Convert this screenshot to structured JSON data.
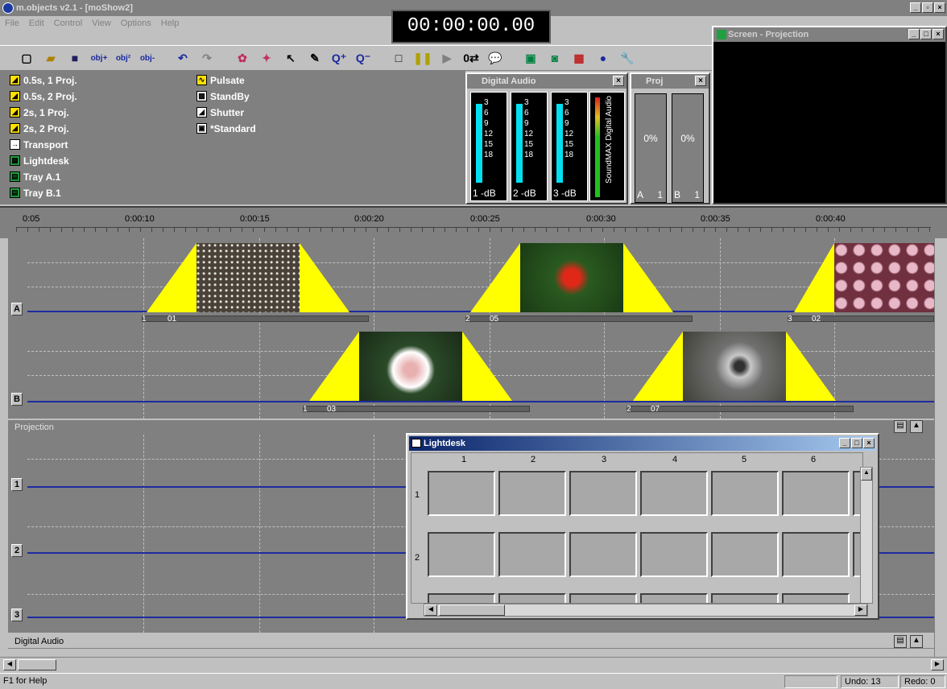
{
  "window": {
    "title": "m.objects v2.1 - [moShow2]"
  },
  "menu": [
    "File",
    "Edit",
    "Control",
    "View",
    "Options",
    "Help"
  ],
  "timer": "00:00:00.00",
  "toolbar": [
    "new",
    "open",
    "save",
    "obj+",
    "obj2",
    "obj-",
    "undo",
    "redo",
    "refresh",
    "select",
    "pointer",
    "pen",
    "zoom-in",
    "zoom-out",
    "stop",
    "pause",
    "play",
    "loop",
    "speech",
    "screen",
    "monitor",
    "lightdesk",
    "paint",
    "wrench"
  ],
  "objects": {
    "col1": [
      "0.5s, 1 Proj.",
      "0.5s, 2 Proj.",
      "2s, 1 Proj.",
      "2s, 2 Proj.",
      "Transport",
      "Lightdesk",
      "Tray A.1",
      "Tray B.1"
    ],
    "col2": [
      "Pulsate",
      "StandBy",
      "Shutter",
      "*Standard"
    ]
  },
  "digital_audio": {
    "title": "Digital Audio",
    "scale": [
      "3",
      "6",
      "9",
      "12",
      "15",
      "18"
    ],
    "channels": [
      "1",
      "2",
      "3"
    ],
    "unit": "-dB",
    "side_label": "SoundMAX Digital Audio"
  },
  "proj": {
    "title": "Proj",
    "cells": [
      {
        "value": "0%",
        "label": "A",
        "num": "1"
      },
      {
        "value": "0%",
        "label": "B",
        "num": "1"
      }
    ]
  },
  "screen": {
    "title": "Screen - Projection"
  },
  "ruler": [
    "0:05",
    "0:00:10",
    "0:00:15",
    "0:00:20",
    "0:00:25",
    "0:00:30",
    "0:00:35",
    "0:00:40"
  ],
  "tracks": {
    "labels": [
      "A",
      "B"
    ],
    "clips": [
      "01",
      "05",
      "02",
      "03",
      "07"
    ],
    "clip_nums": [
      "1",
      "2",
      "3",
      "1",
      "2"
    ]
  },
  "projection_label": "Projection",
  "projection_rows": [
    "1",
    "2",
    "3"
  ],
  "lightdesk": {
    "title": "Lightdesk",
    "cols": [
      "1",
      "2",
      "3",
      "4",
      "5",
      "6"
    ],
    "rows": [
      "1",
      "2"
    ]
  },
  "digital_audio_label": "Digital Audio",
  "status": {
    "help": "F1 for Help",
    "undo": "Undo: 13",
    "redo": "Redo: 0"
  }
}
